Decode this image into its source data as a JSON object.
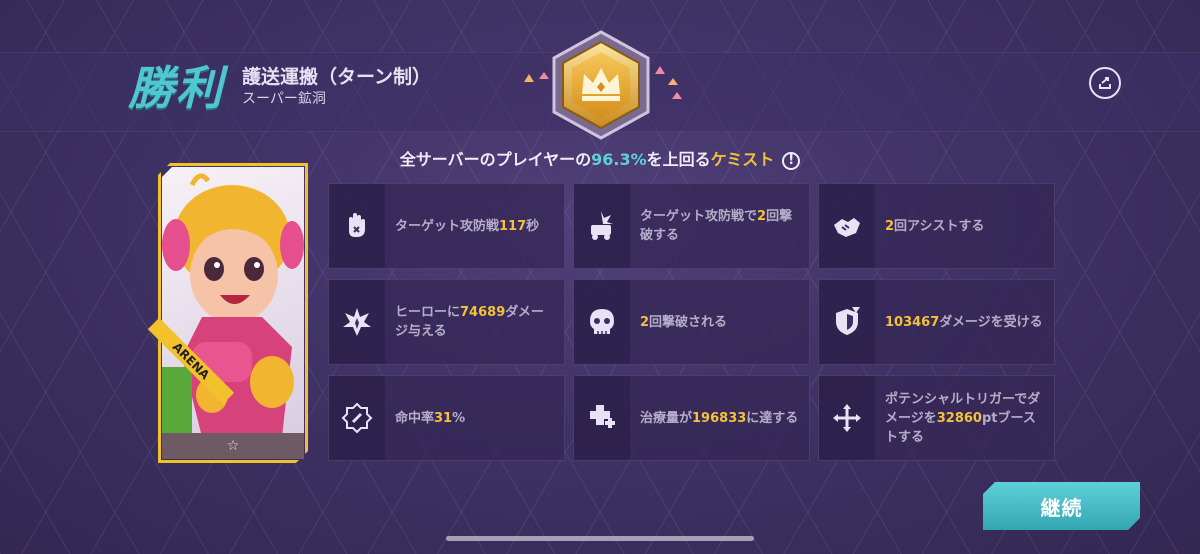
{
  "header": {
    "result": "勝利",
    "mode": "護送運搬（ターン制）",
    "map": "スーパー鉱洞"
  },
  "summary": {
    "prefix": "全サーバーのプレイヤーの",
    "percent": "96.3%",
    "middle": "を上回る",
    "hero": "ケミスト",
    "info_symbol": "!"
  },
  "card": {
    "badge": "ARENA",
    "stars": "☆"
  },
  "stats": [
    {
      "icon": "hand-stop-icon",
      "pre": "ターゲット攻防戦",
      "value": "117",
      "post": "秒"
    },
    {
      "icon": "cart-explosion-icon",
      "pre": "ターゲット攻防戦で",
      "value": "2",
      "post": "回撃破する"
    },
    {
      "icon": "handshake-icon",
      "pre": "",
      "value": "2",
      "post": "回アシストする"
    },
    {
      "icon": "damage-burst-icon",
      "pre": "ヒーローに",
      "value": "74689",
      "post": "ダメージ与える"
    },
    {
      "icon": "skull-icon",
      "pre": "",
      "value": "2",
      "post": "回撃破される"
    },
    {
      "icon": "shield-hit-icon",
      "pre": "",
      "value": "103467",
      "post": "ダメージを受ける"
    },
    {
      "icon": "accuracy-badge-icon",
      "pre": "命中率",
      "value": "31",
      "post": "%"
    },
    {
      "icon": "heal-plus-icon",
      "pre": "治療量が",
      "value": "196833",
      "post": "に達する"
    },
    {
      "icon": "move-arrows-icon",
      "pre": "ポテンシャルトリガーでダメージを",
      "value": "32860",
      "post": "ptブーストする"
    }
  ],
  "buttons": {
    "continue": "継続"
  },
  "colors": {
    "accent_cyan": "#4fc7d0",
    "highlight_gold": "#f4c23a",
    "background": "#3f3265"
  }
}
